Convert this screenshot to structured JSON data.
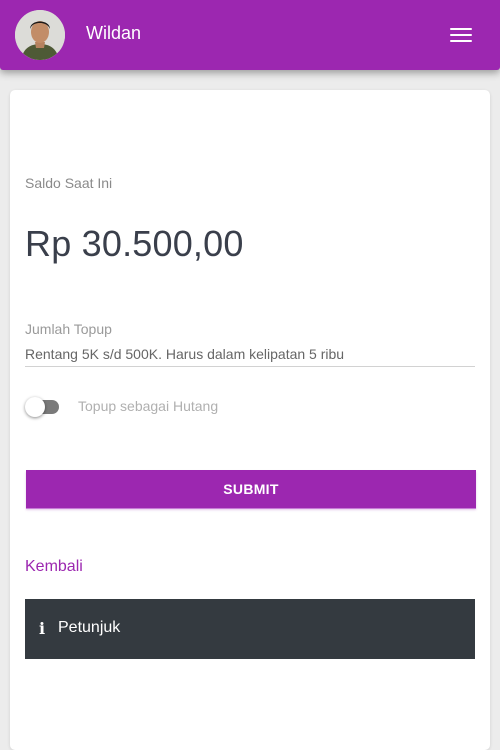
{
  "header": {
    "username": "Wildan",
    "avatar_icon": "user-avatar",
    "menu_icon": "hamburger-menu-icon",
    "bar_color": "#9c27b0"
  },
  "balance": {
    "label": "Saldo Saat Ini",
    "value": "Rp 30.500,00"
  },
  "topup": {
    "label": "Jumlah Topup",
    "placeholder": "Rentang 5K s/d 500K. Harus dalam kelipatan 5 ribu",
    "value": ""
  },
  "debt_toggle": {
    "label": "Topup sebagai Hutang",
    "checked": false
  },
  "submit_label": "SUBMIT",
  "back_label": "Kembali",
  "help": {
    "icon": "info-icon",
    "label": "Petunjuk"
  },
  "colors": {
    "accent": "#9c27b0",
    "dark_panel": "#343a40"
  }
}
